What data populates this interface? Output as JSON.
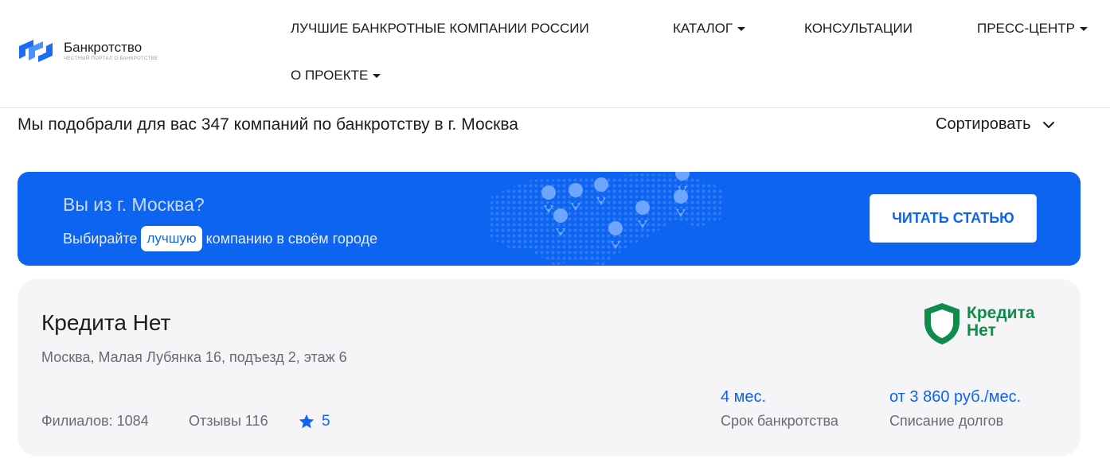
{
  "header": {
    "logo_name": "Банкротство",
    "logo_tagline": "ЧЕСТНЫЙ ПОРТАЛ О БАНКРОТСТВЕ",
    "nav": {
      "best": "ЛУЧШИЕ БАНКРОТНЫЕ КОМПАНИИ РОССИИ",
      "catalog": "КАТАЛОГ",
      "consult": "КОНСУЛЬТАЦИИ",
      "press": "ПРЕСС-ЦЕНТР",
      "about": "О ПРОЕКТЕ"
    }
  },
  "results": {
    "text": "Мы подобрали для вас 347 компаний по банкротству в г. Москва",
    "sort_label": "Сортировать",
    "sort_icon": "chevron-down-icon"
  },
  "banner": {
    "title": "Вы из г. Москва?",
    "sub_before": "Выбирайте",
    "sub_highlight": "лучшую",
    "sub_after": "компанию в своём городе",
    "button": "ЧИТАТЬ СТАТЬЮ",
    "map_icon": "map-pin-icon"
  },
  "company": {
    "name": "Кредита Нет",
    "address": "Москва, Малая Лубянка 16, подъезд 2, этаж 6",
    "logo_line1": "Кредита",
    "logo_line2": "Нет",
    "branches": "Филиалов: 1084",
    "reviews": "Отзывы 116",
    "rating": "5",
    "term_value": "4 мес.",
    "term_label": "Срок банкротства",
    "price_value": "от 3 860 руб./мес.",
    "price_label": "Списание долгов"
  },
  "colors": {
    "accent": "#0d64f0",
    "brand_green": "#0e8c4a",
    "card_bg": "#f5f5f7"
  }
}
